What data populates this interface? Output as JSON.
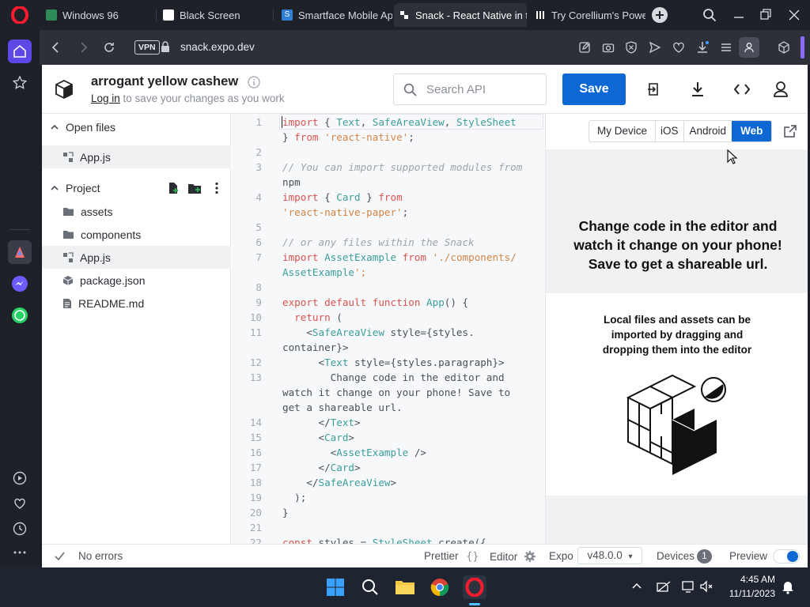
{
  "tabs": [
    {
      "label": "Windows 96",
      "favicon_color": "#3cb371"
    },
    {
      "label": "Black Screen",
      "favicon_color": "#ffffff"
    },
    {
      "label": "Smartface Mobile App",
      "favicon_color": "#2f7fd6"
    },
    {
      "label": "Snack - React Native in the",
      "favicon_color": "#ffffff"
    },
    {
      "label": "Try Corellium's Powerf",
      "favicon_color": "#ffffff"
    }
  ],
  "browser": {
    "vpn_label": "VPN",
    "url_domain": "snack.expo.dev",
    "accent": "#0d68d4"
  },
  "header": {
    "project_name": "arrogant yellow cashew",
    "login_link": "Log in",
    "login_hint": " to save your changes as you work",
    "search_placeholder": "Search API",
    "save_label": "Save"
  },
  "file_panel": {
    "open_files_title": "Open files",
    "open_files": [
      "App.js"
    ],
    "project_title": "Project",
    "items": [
      {
        "name": "assets",
        "kind": "folder"
      },
      {
        "name": "components",
        "kind": "folder"
      },
      {
        "name": "App.js",
        "kind": "file",
        "selected": true
      },
      {
        "name": "package.json",
        "kind": "package"
      },
      {
        "name": "README.md",
        "kind": "doc"
      }
    ]
  },
  "editor": {
    "line_numbers": [
      "1",
      "",
      "2",
      "3",
      "",
      "4",
      "",
      "5",
      "6",
      "7",
      "",
      "8",
      "9",
      "10",
      "11",
      "",
      "12",
      "13",
      "",
      "",
      "14",
      "15",
      "16",
      "17",
      "18",
      "19",
      "20",
      "21",
      "22"
    ],
    "lines": [
      "import { Text, SafeAreaView, StyleSheet",
      "} from 'react-native';",
      "",
      "// You can import supported modules from",
      "npm",
      "import { Card } from",
      "'react-native-paper';",
      "",
      "// or any files within the Snack",
      "import AssetExample from './components/",
      "AssetExample';",
      "",
      "export default function App() {",
      "  return (",
      "    <SafeAreaView style={styles.",
      "container}>",
      "      <Text style={styles.paragraph}>",
      "        Change code in the editor and",
      "watch it change on your phone! Save to",
      "get a shareable url.",
      "      </Text>",
      "      <Card>",
      "        <AssetExample />",
      "      </Card>",
      "    </SafeAreaView>",
      "  );",
      "}",
      "",
      "const styles = StyleSheet.create({"
    ]
  },
  "preview": {
    "device_tabs": [
      "My Device",
      "iOS",
      "Android",
      "Web"
    ],
    "active_tab": "Web",
    "paragraph": "Change code in the editor and watch it change on your phone! Save to get a shareable url.",
    "card_text": "Local files and assets can be imported by dragging and dropping them into the editor"
  },
  "status": {
    "errors": "No errors",
    "prettier": "Prettier",
    "prettier_icon": "{}",
    "editor_label": "Editor",
    "expo_label": "Expo",
    "sdk_version": "v48.0.0",
    "sdk_caret": "▾",
    "devices_label": "Devices",
    "devices_count": "1",
    "preview_label": "Preview"
  },
  "taskbar": {
    "time": "4:45 AM",
    "date": "11/11/2023"
  }
}
